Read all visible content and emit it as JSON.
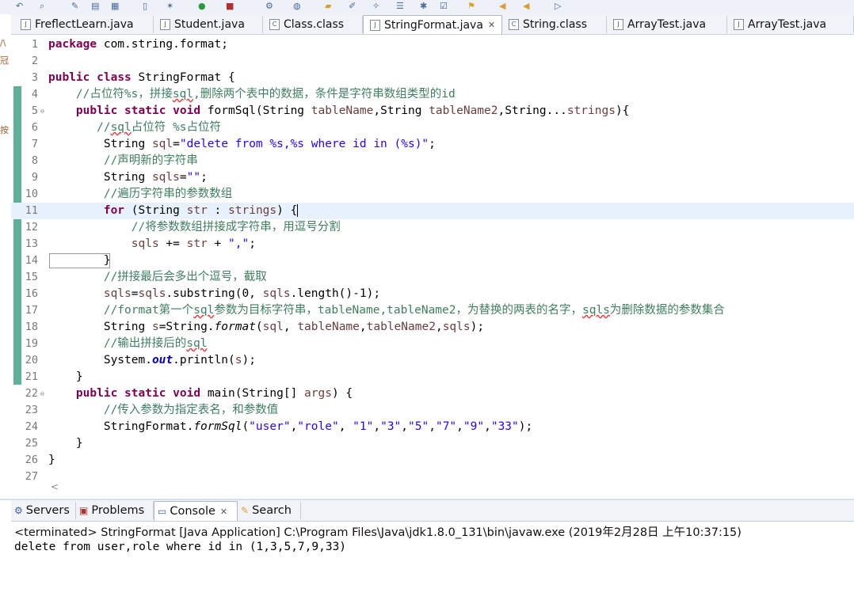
{
  "editor_tabs": [
    {
      "label": "FreflectLearn.java",
      "active": false
    },
    {
      "label": "Student.java",
      "active": false
    },
    {
      "label": "Class.class",
      "active": false
    },
    {
      "label": "StringFormat.java",
      "active": true
    },
    {
      "label": "String.class",
      "active": false
    },
    {
      "label": "ArrayTest.java",
      "active": false
    },
    {
      "label": "ArrayTest.java",
      "active": false
    }
  ],
  "code": {
    "l1": {
      "n": "1",
      "t": [
        "package",
        " com.string.format;"
      ]
    },
    "l2": {
      "n": "2"
    },
    "l3": {
      "n": "3",
      "t": [
        "public",
        " ",
        "class",
        " StringFormat {"
      ]
    },
    "l4": {
      "n": "4",
      "t": [
        "    //占位符%s，拼接",
        "sql",
        ",删除两个表中的数据，条件是字符串数组类型的id"
      ]
    },
    "l5": {
      "n": "5",
      "t": [
        "    ",
        "public",
        " ",
        "static",
        " ",
        "void",
        " formSql(String ",
        "tableName",
        ",String ",
        "tableName2",
        ",String...",
        "strings",
        "){"
      ]
    },
    "l6": {
      "n": "6",
      "t": [
        "       //",
        "sql",
        "占位符 %s占位符"
      ]
    },
    "l7": {
      "n": "7",
      "t": [
        "        String ",
        "sql",
        "=",
        "\"delete from %s,%s where id in (%s)\"",
        ";"
      ]
    },
    "l8": {
      "n": "8",
      "t": [
        "        //声明新的字符串"
      ]
    },
    "l9": {
      "n": "9",
      "t": [
        "        String ",
        "sqls",
        "=",
        "\"\"",
        ";"
      ]
    },
    "l10": {
      "n": "10",
      "t": [
        "        //遍历字符串的参数数组"
      ]
    },
    "l11": {
      "n": "11",
      "t": [
        "        ",
        "for",
        " (String ",
        "str",
        " : ",
        "strings",
        ") {"
      ]
    },
    "l12": {
      "n": "12",
      "t": [
        "            //将参数数组拼接成字符串，用逗号分割"
      ]
    },
    "l13": {
      "n": "13",
      "t": [
        "            ",
        "sqls",
        " += ",
        "str",
        " + ",
        "\",\"",
        ";"
      ]
    },
    "l14": {
      "n": "14",
      "t": [
        "        }"
      ]
    },
    "l15": {
      "n": "15",
      "t": [
        "        //拼接最后会多出个逗号，截取"
      ]
    },
    "l16": {
      "n": "16",
      "t": [
        "        ",
        "sqls",
        "=",
        "sqls",
        ".substring(0, ",
        "sqls",
        ".length()-1);"
      ]
    },
    "l17": {
      "n": "17",
      "t": [
        "        //format第一个",
        "sql",
        "参数为目标字符串，tableName,tableName2，为替换的两表的名字，",
        "sqls",
        "为删除数据的参数集合"
      ]
    },
    "l18": {
      "n": "18",
      "t": [
        "        String ",
        "s",
        "=String.",
        "format",
        "(",
        "sql",
        ", ",
        "tableName",
        ",",
        "tableName2",
        ",",
        "sqls",
        ");"
      ]
    },
    "l19": {
      "n": "19",
      "t": [
        "        //输出拼接后的",
        "sql"
      ]
    },
    "l20": {
      "n": "20",
      "t": [
        "        System.",
        "out",
        ".println(",
        "s",
        ");"
      ]
    },
    "l21": {
      "n": "21",
      "t": [
        "    }"
      ]
    },
    "l22": {
      "n": "22",
      "t": [
        "    ",
        "public",
        " ",
        "static",
        " ",
        "void",
        " main(String[] ",
        "args",
        ") {"
      ]
    },
    "l23": {
      "n": "23",
      "t": [
        "        //传入参数为指定表名，和参数值"
      ]
    },
    "l24": {
      "n": "24",
      "t": [
        "        StringFormat.",
        "formSql",
        "(",
        "\"user\"",
        ",",
        "\"role\"",
        ", ",
        "\"1\"",
        ",",
        "\"3\"",
        ",",
        "\"5\"",
        ",",
        "\"7\"",
        ",",
        "\"9\"",
        ",",
        "\"33\"",
        ");"
      ]
    },
    "l25": {
      "n": "25",
      "t": [
        "    }"
      ]
    },
    "l26": {
      "n": "26",
      "t": [
        "}"
      ]
    },
    "l27": {
      "n": "27"
    }
  },
  "panel_tabs": [
    {
      "label": "Servers"
    },
    {
      "label": "Problems"
    },
    {
      "label": "Console"
    },
    {
      "label": "Search"
    }
  ],
  "console": {
    "title": "<terminated> StringFormat [Java Application] C:\\Program Files\\Java\\jdk1.8.0_131\\bin\\javaw.exe (2019年2月28日 上午10:37:15)",
    "output": "delete from user,role where id in (1,3,5,7,9,33)"
  },
  "colors": {
    "keyword": "#7f0055",
    "comment": "#3f7f5f",
    "string": "#2a00ff",
    "field": "#0000c0",
    "current_line": "#e8f2fe"
  }
}
